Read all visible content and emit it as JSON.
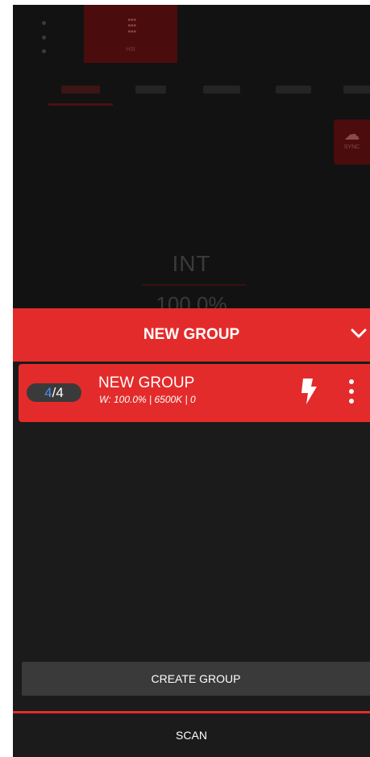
{
  "background": {
    "mode_label": "HSI",
    "tabs": [
      "WHITE",
      "CCT",
      "HSI",
      "EFFECTS",
      "PRESETS"
    ],
    "cloud_label": "SYNC",
    "intensity_label": "INT",
    "intensity_value": "100.0%"
  },
  "sheet": {
    "title": "NEW GROUP",
    "collapse_icon": "chevron-down-icon"
  },
  "group": {
    "count_current": "4",
    "count_separator": "/",
    "count_total": "4",
    "name": "NEW GROUP",
    "meta": "W: 100.0% | 6500K | 0",
    "flash_icon": "flash-icon",
    "menu_icon": "kebab-menu-icon"
  },
  "actions": {
    "create_label": "CREATE GROUP",
    "scan_label": "SCAN"
  },
  "colors": {
    "accent": "#e42b2b",
    "surface": "#1b1b1b",
    "button": "#3a3a3a",
    "count_highlight": "#4d8ff0"
  }
}
